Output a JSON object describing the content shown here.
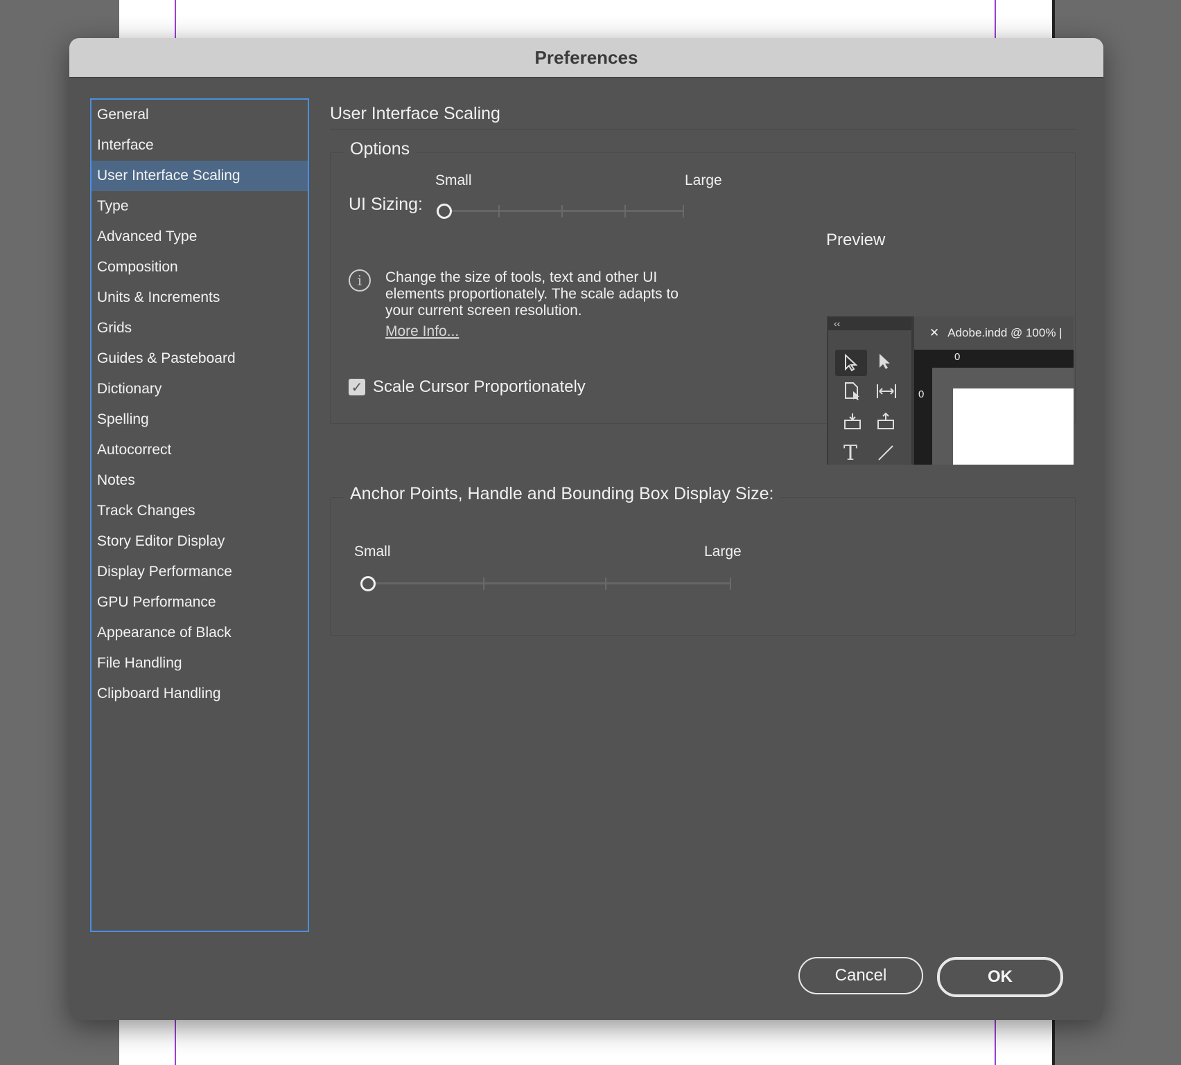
{
  "dialog": {
    "title": "Preferences"
  },
  "sidebar": {
    "items": [
      {
        "label": "General"
      },
      {
        "label": "Interface"
      },
      {
        "label": "User Interface Scaling",
        "selected": true
      },
      {
        "label": "Type"
      },
      {
        "label": "Advanced Type"
      },
      {
        "label": "Composition"
      },
      {
        "label": "Units & Increments"
      },
      {
        "label": "Grids"
      },
      {
        "label": "Guides & Pasteboard"
      },
      {
        "label": "Dictionary"
      },
      {
        "label": "Spelling"
      },
      {
        "label": "Autocorrect"
      },
      {
        "label": "Notes"
      },
      {
        "label": "Track Changes"
      },
      {
        "label": "Story Editor Display"
      },
      {
        "label": "Display Performance"
      },
      {
        "label": "GPU Performance"
      },
      {
        "label": "Appearance of Black"
      },
      {
        "label": "File Handling"
      },
      {
        "label": "Clipboard Handling"
      }
    ]
  },
  "main": {
    "title": "User Interface Scaling",
    "options": {
      "legend": "Options",
      "ui_sizing_label": "UI Sizing:",
      "slider_min_label": "Small",
      "slider_max_label": "Large",
      "slider_value_step": 0,
      "slider_steps": 5,
      "preview_label": "Preview",
      "info_text": "Change the size of tools, text and other UI elements proportionately. The scale adapts to your current screen resolution.",
      "more_info_link": "More Info...",
      "scale_cursor_label": "Scale Cursor Proportionately",
      "scale_cursor_checked": true
    },
    "anchor": {
      "legend": "Anchor Points, Handle and Bounding Box Display Size:",
      "slider_min_label": "Small",
      "slider_max_label": "Large",
      "slider_value_step": 0,
      "slider_steps": 4
    },
    "preview": {
      "tab_title": "Adobe.indd @ 100% |",
      "collapse_glyph": "‹‹",
      "close_glyph": "✕",
      "ruler_zero_h": "0",
      "ruler_zero_v": "0"
    }
  },
  "footer": {
    "cancel_label": "Cancel",
    "ok_label": "OK"
  },
  "colors": {
    "dialog_bg": "#535353",
    "selection": "#4d6887",
    "focus_border": "#4a8fe0",
    "guide": "#9a3fd6"
  }
}
